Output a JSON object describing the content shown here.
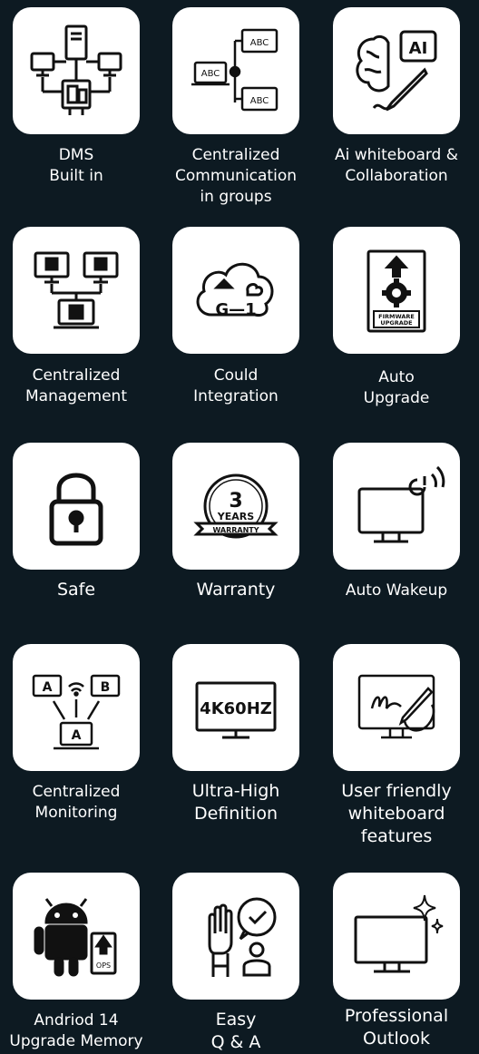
{
  "features": [
    {
      "icon": "network-computers-icon",
      "lines": [
        "DMS",
        "Built in"
      ]
    },
    {
      "icon": "centralized-communication-icon",
      "lines": [
        "Centralized",
        "Communication",
        "in groups"
      ]
    },
    {
      "icon": "ai-brain-pen-icon",
      "lines": [
        "Ai whiteboard &",
        "Collaboration"
      ]
    },
    {
      "icon": "centralized-management-icon",
      "lines": [
        "Centralized",
        "Management"
      ]
    },
    {
      "icon": "cloud-integration-icon",
      "lines": [
        "Could",
        "Integration"
      ]
    },
    {
      "icon": "firmware-upgrade-icon",
      "lines": [
        "Auto",
        "Upgrade"
      ]
    },
    {
      "icon": "padlock-icon",
      "lines": [
        "Safe"
      ]
    },
    {
      "icon": "warranty-badge-icon",
      "lines": [
        "Warranty"
      ]
    },
    {
      "icon": "wakeup-monitor-icon",
      "lines": [
        "Auto Wakeup"
      ]
    },
    {
      "icon": "centralized-monitoring-icon",
      "lines": [
        "Centralized",
        "Monitoring"
      ]
    },
    {
      "icon": "4k-display-icon",
      "lines": [
        "Ultra-High",
        "Definition"
      ]
    },
    {
      "icon": "whiteboard-hand-icon",
      "lines": [
        "User friendly",
        "whiteboard",
        "features"
      ]
    },
    {
      "icon": "android-ops-icon",
      "lines": [
        "Andriod 14",
        "Upgrade Memory"
      ]
    },
    {
      "icon": "raised-hand-check-icon",
      "lines": [
        "Easy",
        "Q & A"
      ]
    },
    {
      "icon": "sparkle-monitor-icon",
      "lines": [
        "Professional",
        "Outlook"
      ]
    }
  ],
  "tile_text": {
    "abc": "ABC",
    "ai": "AI",
    "g1": "G—1",
    "firmware": "FIRMWARE",
    "upgrade": "UPGRADE",
    "years_num": "3",
    "years": "YEARS",
    "warranty": "WARRANTY",
    "a": "A",
    "b": "B",
    "res": "4K60HZ",
    "ops": "OPS"
  }
}
